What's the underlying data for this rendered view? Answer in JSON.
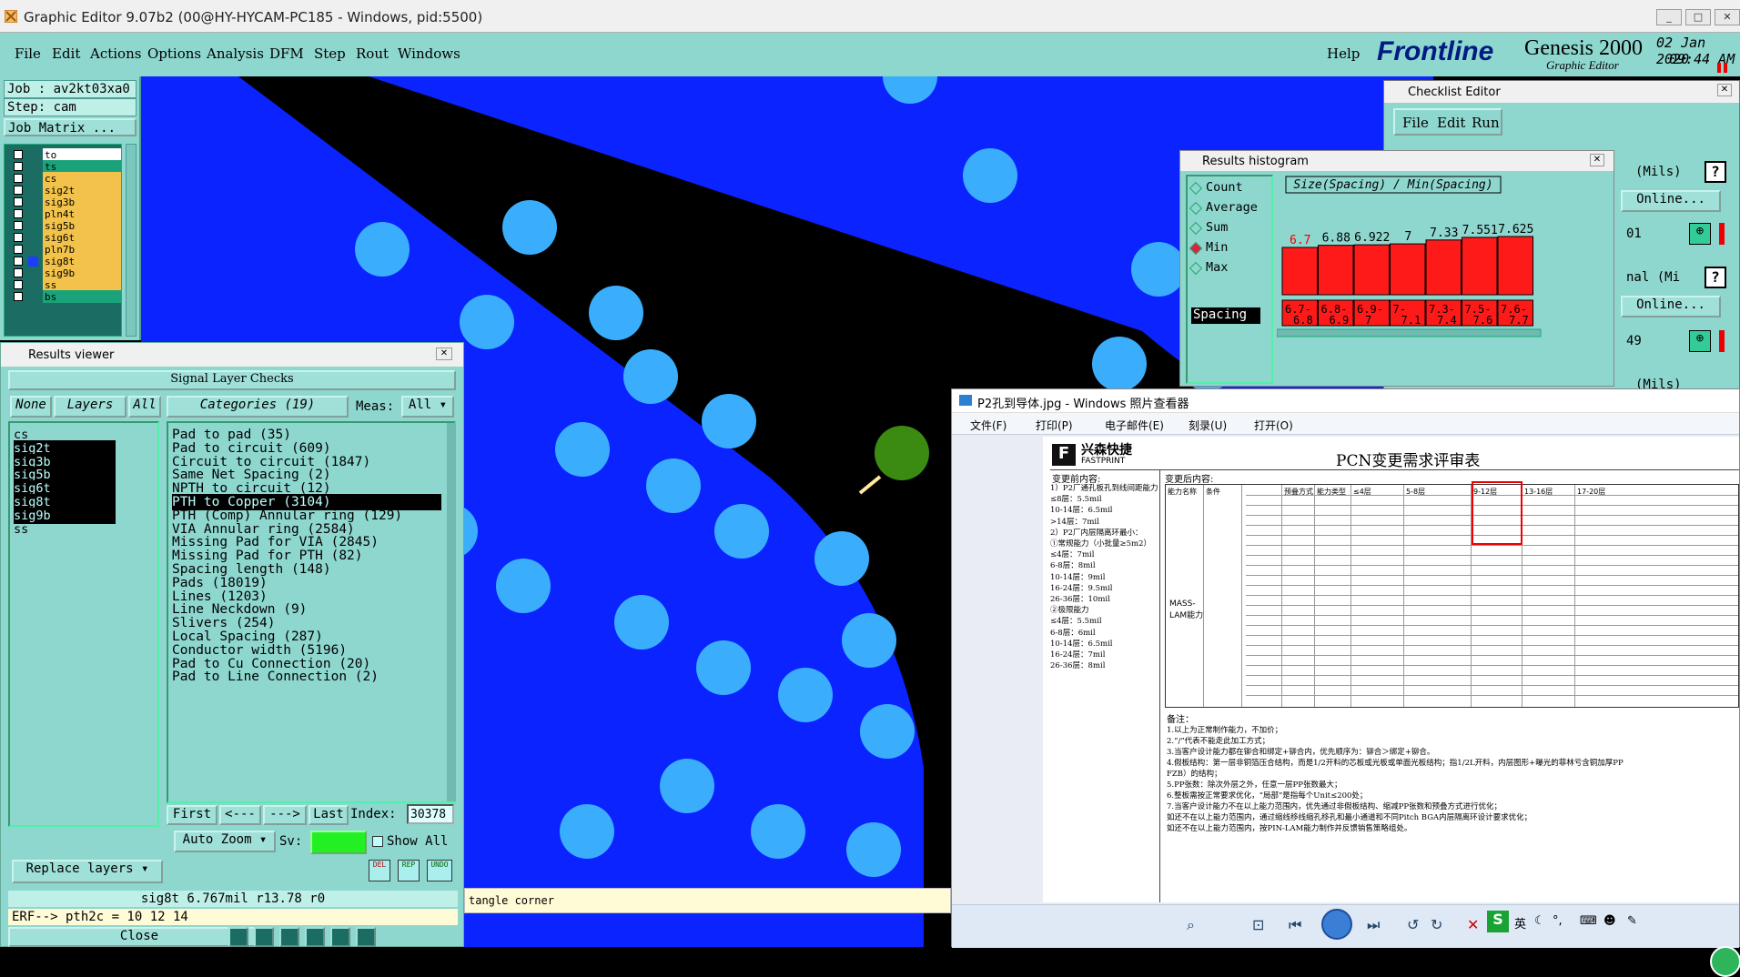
{
  "window": {
    "title": "Graphic Editor 9.07b2 (00@HY-HYCAM-PC185 - Windows, pid:5500)"
  },
  "menu": {
    "items": [
      "File",
      "Edit",
      "Actions",
      "Options",
      "Analysis",
      "DFM",
      "Step",
      "Rout",
      "Windows"
    ],
    "help": "Help"
  },
  "brand": {
    "logo": "Frontline",
    "product": "Genesis 2000",
    "sub": "Graphic Editor",
    "date": "02 Jan 2020",
    "time": "09:44 AM"
  },
  "job": {
    "job_line": "Job : av2kt03xa0",
    "step_line": "Step: cam",
    "matrix_btn": "Job Matrix ..."
  },
  "layers": [
    {
      "name": "to",
      "color": "#ffffff"
    },
    {
      "name": "ts",
      "color": "#1aa37a"
    },
    {
      "name": "cs",
      "color": "#f2c24a"
    },
    {
      "name": "sig2t",
      "color": "#f2c24a"
    },
    {
      "name": "sig3b",
      "color": "#f2c24a"
    },
    {
      "name": "pln4t",
      "color": "#f2c24a"
    },
    {
      "name": "sig5b",
      "color": "#f2c24a"
    },
    {
      "name": "sig6t",
      "color": "#f2c24a"
    },
    {
      "name": "pln7b",
      "color": "#f2c24a"
    },
    {
      "name": "sig8t",
      "color": "#f2c24a"
    },
    {
      "name": "sig9b",
      "color": "#f2c24a"
    },
    {
      "name": "ss",
      "color": "#f2c24a"
    },
    {
      "name": "bs",
      "color": "#1aa37a"
    }
  ],
  "results_viewer": {
    "title": "Results viewer",
    "header": "Signal Layer Checks",
    "none": "None",
    "layers": "Layers",
    "all": "All",
    "categories_btn": "Categories (19)",
    "meas_label": "Meas:",
    "meas_value": "All",
    "layer_list": [
      "cs",
      "sig2t",
      "sig3b",
      "sig5b",
      "sig6t",
      "sig8t",
      "sig9b",
      "ss"
    ],
    "categories": [
      "Pad to pad (35)",
      "Pad to circuit (609)",
      "Circuit to circuit (1847)",
      "Same Net Spacing (2)",
      "NPTH to circuit (12)",
      "PTH to Copper (3104)",
      "PTH (Comp) Annular ring (129)",
      "VIA Annular ring (2584)",
      "Missing Pad for VIA (2845)",
      "Missing Pad for PTH (82)",
      "Spacing length (148)",
      "Pads (18019)",
      "Lines (1203)",
      "Line Neckdown (9)",
      "Slivers (254)",
      "Local Spacing (287)",
      "Conductor width (5196)",
      "Pad to Cu Connection (20)",
      "Pad to Line Connection (2)"
    ],
    "selected_category": "PTH to Copper (3104)",
    "nav": {
      "first": "First",
      "prev": "<---",
      "next": "--->",
      "last": "Last",
      "index_label": "Index:",
      "index_value": "30378"
    },
    "auto_zoom": "Auto Zoom",
    "sv": "Sv:",
    "show_all": "Show All",
    "replace_layers": "Replace layers",
    "status": "sig8t 6.767mil  r13.78  r0",
    "erf": "ERF--> pth2c = 10 12 14",
    "close": "Close",
    "tool_icons": [
      "DEL",
      "REP",
      "UNDO"
    ]
  },
  "bottom_status": "tangle corner",
  "checklist": {
    "title": "Checklist Editor",
    "menu": [
      "File",
      "Edit",
      "Run"
    ],
    "mils1": "(Mils)",
    "online": "Online...",
    "v01": "01",
    "nal": "nal (Mi",
    "online2": "Online...",
    "v49": "49",
    "mils3": "(Mils)"
  },
  "histogram": {
    "title": "Results histogram",
    "options": [
      "Count",
      "Average",
      "Sum",
      "Min",
      "Max"
    ],
    "selected": "Min",
    "spacing": "Spacing",
    "chart_title": "Size(Spacing) / Min(Spacing)"
  },
  "chart_data": {
    "type": "bar",
    "title": "Size(Spacing) / Min(Spacing)",
    "categories": [
      "6.7-6.8",
      "6.8-6.9",
      "6.9-7",
      "7-7.1",
      "7.3-7.4",
      "7.5-7.6",
      "7.6-7.7"
    ],
    "category_labels": [
      [
        "6.7-",
        "6.8"
      ],
      [
        "6.8-",
        "6.9"
      ],
      [
        "6.9-",
        "7"
      ],
      [
        "7-",
        "7.1"
      ],
      [
        "7.3-",
        "7.4"
      ],
      [
        "7.5-",
        "7.6"
      ],
      [
        "7.6-",
        "7.7"
      ]
    ],
    "values": [
      6.7,
      6.88,
      6.922,
      7,
      7.33,
      7.551,
      7.625
    ],
    "value_labels": [
      "6.7",
      "6.88",
      "6.922",
      "7",
      "7.33",
      "7.551",
      "7.625"
    ],
    "bar_color": "#ff1a1a"
  },
  "photo_viewer": {
    "title": "P2孔到导体.jpg - Windows 照片查看器",
    "menu": [
      "文件(F)",
      "打印(P)",
      "电子邮件(E)",
      "刻录(U)",
      "打开(O)"
    ],
    "doc_logo": "兴森快捷",
    "doc_logo_en": "FASTPRINT",
    "doc_title": "PCN变更需求评审表",
    "before_label": "变更前内容:",
    "after_label": "变更后内容:",
    "left_notes": [
      "1）P2厂通孔板孔到线间距能力：",
      "≤8层：5.5mil",
      "10-14层：6.5mil",
      ">14层：7mil",
      "2）P2厂内层隔离环最小：",
      "①常规能力（小批量≥5m2）",
      "≤4层：7mil",
      "6-8层：8mil",
      "10-14层：9mil",
      "16-24层：9.5mil",
      "26-36层：10mil",
      "②极限能力",
      "≤4层：5.5mil",
      "6-8层：6mil",
      "10-14层：6.5mil",
      "16-24层：7mil",
      "26-36层：8mil"
    ],
    "table_headers": [
      "能力名称",
      "条件",
      "",
      "预叠方式",
      "能力类型",
      "≤4层",
      "5-8层",
      "9-12层",
      "13-16层",
      "17-20层"
    ],
    "mass_lam": "MASS-LAM能力",
    "notes_title": "备注：",
    "notes": [
      "1.以上为正常制作能力，不加价；",
      "2.“/”代表不能走此加工方式；",
      "3.当客户设计能力都在铆合和绑定+铆合内，优先顺序为：铆合＞绑定+铆合。",
      "4.假板结构：第一层非铜箔压合结构，而是1/2开料的芯板或光板或单面光板结构；指1/2L开料，内层图形+曝光的菲林亏含铜加厚PP",
      "FZB）的结构；",
      "5.PP张数：除次外层之外，任意一层PP张数最大；",
      "6.整板需按正常要求优化，“局部”是指每个Unit≤200处；",
      "7.当客户设计能力不在以上能力范围内，优先通过非假板结构、缩减PP张数和预叠方式进行优化；",
      "如还不在以上能力范围内，通过缩线移线缩孔移孔和最小通道和不同Pitch BGA内层隔离环设计要求优化；",
      "如还不在以上能力范围内，按PIN-LAM能力制作并反馈销售策略组处。"
    ],
    "tray_text": "英"
  }
}
